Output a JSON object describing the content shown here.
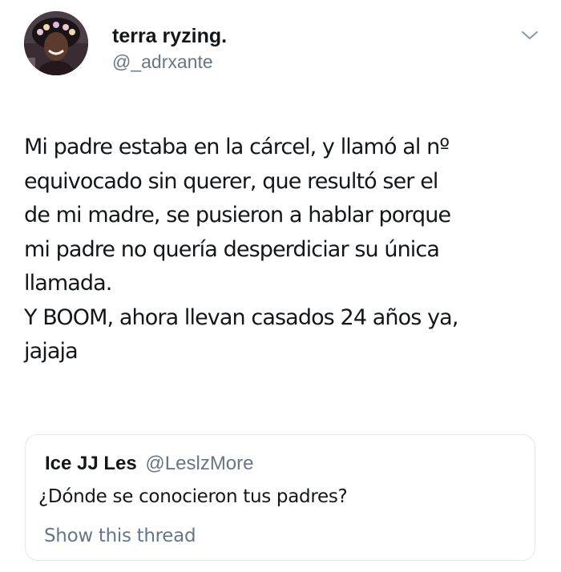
{
  "author": {
    "display_name": "terra ryzing.",
    "handle": "@_adrxante"
  },
  "tweet": {
    "text": "Mi padre estaba en la cárcel, y llamó al nº\nequivocado sin querer, que resultó ser el\nde mi madre, se pusieron a hablar porque\nmi padre no quería desperdiciar su única\nllamada.\nY BOOM, ahora llevan casados 24 años ya,\njajaja"
  },
  "quoted_tweet": {
    "display_name": "Ice JJ Les",
    "handle": "@LeslzMore",
    "text": "¿Dónde se conocieron tus padres?",
    "show_thread_label": "Show this thread"
  },
  "icons": {
    "menu": "chevron-down-icon",
    "avatar": "avatar"
  },
  "colors": {
    "text_primary": "#14171a",
    "text_secondary": "#657786",
    "border": "#e1e8ed"
  }
}
